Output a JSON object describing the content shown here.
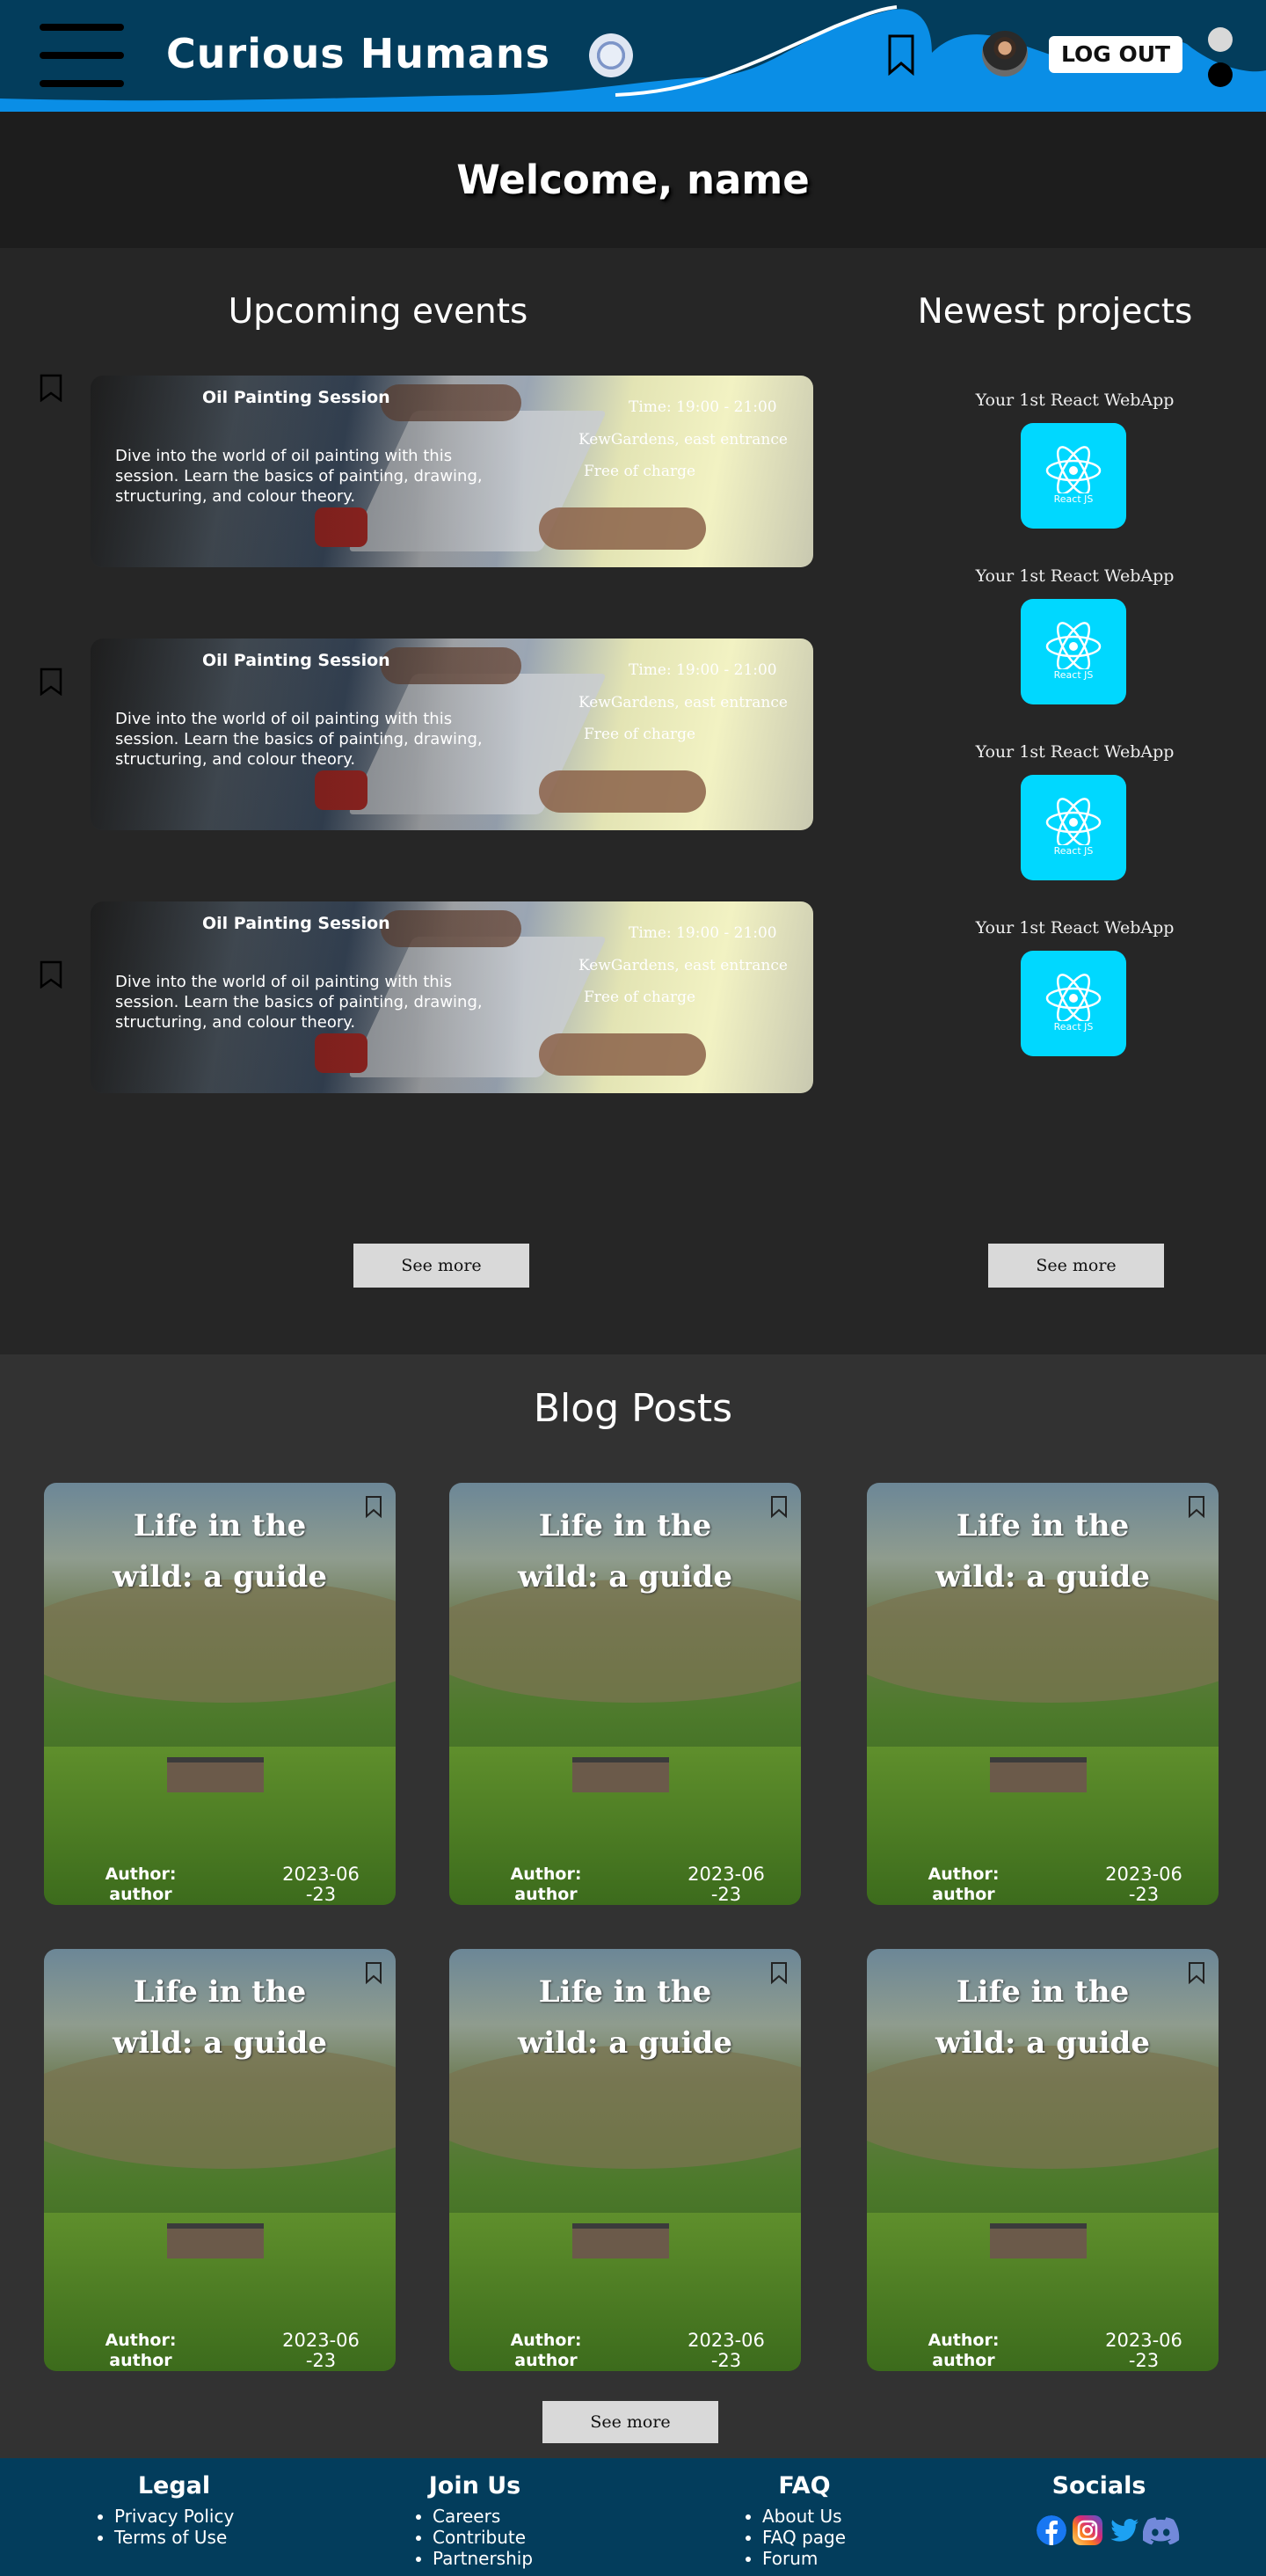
{
  "header": {
    "brand": "Curious Humans",
    "logout_label": "LOG OUT"
  },
  "welcome": {
    "title": "Welcome, name"
  },
  "events": {
    "section_title": "Upcoming events",
    "items": [
      {
        "title": "Oil Painting Session",
        "description": "Dive into the world of oil painting with this session. Learn the basics of painting, drawing, structuring, and colour theory.",
        "time": "Time: 19:00 - 21:00",
        "place": "KewGardens, east entrance",
        "price": "Free of charge"
      },
      {
        "title": "Oil Painting Session",
        "description": "Dive into the world of oil painting with this session. Learn the basics of painting, drawing, structuring, and colour theory.",
        "time": "Time: 19:00 - 21:00",
        "place": "KewGardens, east entrance",
        "price": "Free of charge"
      },
      {
        "title": "Oil Painting Session",
        "description": "Dive into the world of oil painting with this session. Learn the basics of painting, drawing, structuring, and colour theory.",
        "time": "Time: 19:00 - 21:00",
        "place": "KewGardens, east entrance",
        "price": "Free of charge"
      }
    ],
    "see_more_label": "See more"
  },
  "projects": {
    "section_title": "Newest projects",
    "items": [
      {
        "label": "Your 1st React WebApp",
        "icon_caption": "React JS"
      },
      {
        "label": "Your 1st React WebApp",
        "icon_caption": "React JS"
      },
      {
        "label": "Your 1st React WebApp",
        "icon_caption": "React JS"
      },
      {
        "label": "Your 1st React WebApp",
        "icon_caption": "React JS"
      }
    ],
    "see_more_label": "See more"
  },
  "blog": {
    "section_title": "Blog Posts",
    "posts": [
      {
        "title_line1": "Life in the",
        "title_line2": "wild: a guide",
        "author_line1": "Author:",
        "author_line2": "author",
        "date_line1": "2023-06",
        "date_line2": "-23"
      },
      {
        "title_line1": "Life in the",
        "title_line2": "wild: a guide",
        "author_line1": "Author:",
        "author_line2": "author",
        "date_line1": "2023-06",
        "date_line2": "-23"
      },
      {
        "title_line1": "Life in the",
        "title_line2": "wild: a guide",
        "author_line1": "Author:",
        "author_line2": "author",
        "date_line1": "2023-06",
        "date_line2": "-23"
      },
      {
        "title_line1": "Life in the",
        "title_line2": "wild: a guide",
        "author_line1": "Author:",
        "author_line2": "author",
        "date_line1": "2023-06",
        "date_line2": "-23"
      },
      {
        "title_line1": "Life in the",
        "title_line2": "wild: a guide",
        "author_line1": "Author:",
        "author_line2": "author",
        "date_line1": "2023-06",
        "date_line2": "-23"
      },
      {
        "title_line1": "Life in the",
        "title_line2": "wild: a guide",
        "author_line1": "Author:",
        "author_line2": "author",
        "date_line1": "2023-06",
        "date_line2": "-23"
      }
    ],
    "see_more_label": "See more"
  },
  "footer": {
    "legal": {
      "heading": "Legal",
      "links": [
        "Privacy Policy",
        "Terms of Use"
      ]
    },
    "join": {
      "heading": "Join Us",
      "links": [
        "Careers",
        "Contribute",
        "Partnership"
      ]
    },
    "faq": {
      "heading": "FAQ",
      "links": [
        "About Us",
        "FAQ page",
        "Forum"
      ]
    },
    "socials": {
      "heading": "Socials",
      "icons": [
        "facebook-icon",
        "instagram-icon",
        "twitter-icon",
        "discord-icon"
      ]
    }
  },
  "colors": {
    "header_bg": "#033d5c",
    "wave": "#0a8ee6",
    "react_tile": "#00d8ff",
    "page_bg": "#262626",
    "blog_bg": "#323232"
  }
}
